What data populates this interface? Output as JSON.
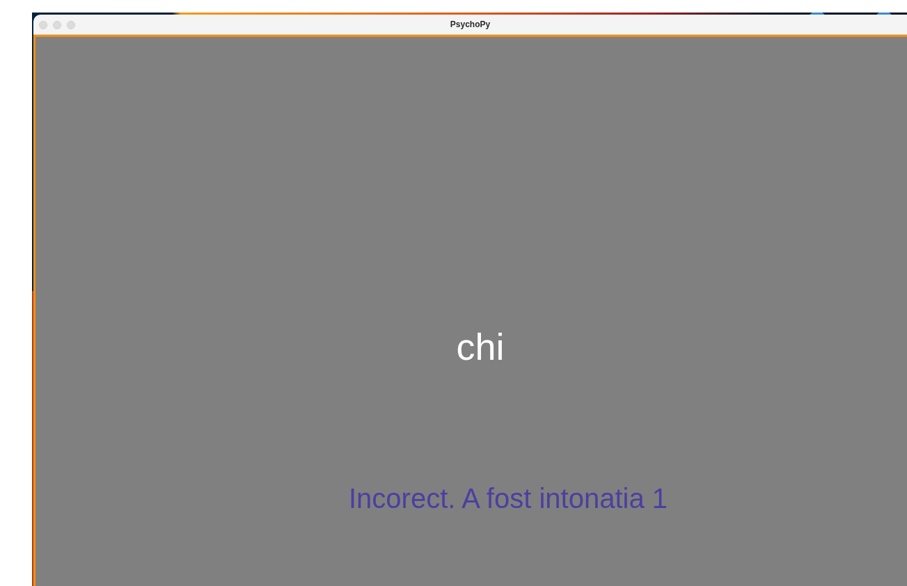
{
  "window": {
    "title": "PsychoPy"
  },
  "stimulus": {
    "text": "chi"
  },
  "feedback": {
    "text": "Incorect. A fost intonatia 1"
  }
}
